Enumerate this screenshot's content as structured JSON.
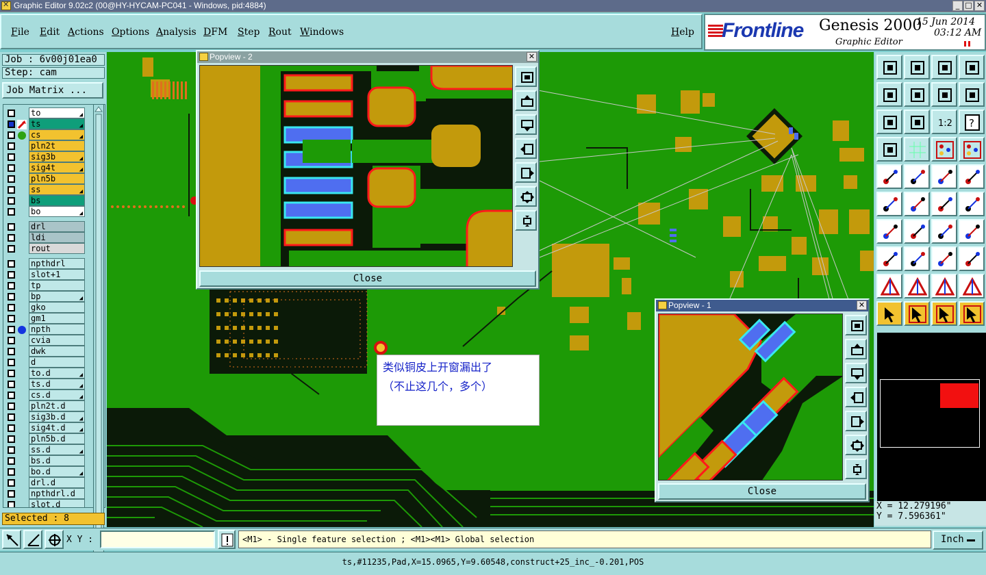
{
  "window": {
    "title": "Graphic Editor 9.02c2 (00@HY-HYCAM-PC041 - Windows, pid:4884)"
  },
  "menu": {
    "items": [
      "File",
      "Edit",
      "Actions",
      "Options",
      "Analysis",
      "DFM",
      "Step",
      "Rout",
      "Windows"
    ],
    "help": "Help"
  },
  "brand": {
    "logo": "Frontline",
    "product": "Genesis 2000",
    "subtitle": "Graphic Editor",
    "date": "15 Jun 2014",
    "time": "03:12 AM"
  },
  "job": {
    "job_label": "Job : 6v00j01ea0",
    "step_label": "Step: cam",
    "matrix_button": "Job Matrix ..."
  },
  "layers": [
    {
      "name": "to",
      "bg": "#ffffff",
      "arrow": true
    },
    {
      "name": "ts",
      "bg": "#0f9e7a",
      "arrow": true,
      "mark": "work"
    },
    {
      "name": "cs",
      "bg": "#f2c22f",
      "arrow": true,
      "mark": "green-dot"
    },
    {
      "name": "pln2t",
      "bg": "#f2c22f",
      "arrow": false
    },
    {
      "name": "sig3b",
      "bg": "#f2c22f",
      "arrow": true
    },
    {
      "name": "sig4t",
      "bg": "#f2c22f",
      "arrow": true
    },
    {
      "name": "pln5b",
      "bg": "#f2c22f",
      "arrow": false
    },
    {
      "name": "ss",
      "bg": "#f2c22f",
      "arrow": true
    },
    {
      "name": "bs",
      "bg": "#0f9e7a",
      "arrow": false
    },
    {
      "name": "bo",
      "bg": "#ffffff",
      "arrow": true
    },
    {
      "name": "drl",
      "bg": "#a9c4c8",
      "arrow": false
    },
    {
      "name": "ldi",
      "bg": "#a9c4c8",
      "arrow": false
    },
    {
      "name": "rout",
      "bg": "#d9d9d9",
      "arrow": false
    },
    {
      "name": "npthdrl",
      "bg": "#bfe8e8",
      "arrow": false
    },
    {
      "name": "slot+1",
      "bg": "#bfe8e8",
      "arrow": false
    },
    {
      "name": "tp",
      "bg": "#bfe8e8",
      "arrow": false
    },
    {
      "name": "bp",
      "bg": "#bfe8e8",
      "arrow": true
    },
    {
      "name": "gko",
      "bg": "#bfe8e8",
      "arrow": false
    },
    {
      "name": "gm1",
      "bg": "#bfe8e8",
      "arrow": false
    },
    {
      "name": "npth",
      "bg": "#bfe8e8",
      "arrow": false,
      "mark": "blue-dot"
    },
    {
      "name": "cvia",
      "bg": "#bfe8e8",
      "arrow": false
    },
    {
      "name": "dwk",
      "bg": "#bfe8e8",
      "arrow": false
    },
    {
      "name": "d",
      "bg": "#bfe8e8",
      "arrow": false
    },
    {
      "name": "to.d",
      "bg": "#bfe8e8",
      "arrow": true
    },
    {
      "name": "ts.d",
      "bg": "#bfe8e8",
      "arrow": true
    },
    {
      "name": "cs.d",
      "bg": "#bfe8e8",
      "arrow": true
    },
    {
      "name": "pln2t.d",
      "bg": "#bfe8e8",
      "arrow": false
    },
    {
      "name": "sig3b.d",
      "bg": "#bfe8e8",
      "arrow": true
    },
    {
      "name": "sig4t.d",
      "bg": "#bfe8e8",
      "arrow": true
    },
    {
      "name": "pln5b.d",
      "bg": "#bfe8e8",
      "arrow": false
    },
    {
      "name": "ss.d",
      "bg": "#bfe8e8",
      "arrow": true
    },
    {
      "name": "bs.d",
      "bg": "#bfe8e8",
      "arrow": false
    },
    {
      "name": "bo.d",
      "bg": "#bfe8e8",
      "arrow": true
    },
    {
      "name": "drl.d",
      "bg": "#bfe8e8",
      "arrow": false
    },
    {
      "name": "npthdrl.d",
      "bg": "#bfe8e8",
      "arrow": false
    },
    {
      "name": "slot.d",
      "bg": "#bfe8e8",
      "arrow": false
    }
  ],
  "selected_label": "Selected : 8",
  "popview2": {
    "title": "Popview - 2",
    "close_label": "Close"
  },
  "popview1": {
    "title": "Popview - 1",
    "close_label": "Close"
  },
  "annotation": {
    "line1": "类似铜皮上开窗漏出了",
    "line2": "（不止这几个，多个）"
  },
  "coordinates": {
    "x": "X = 12.279196\"",
    "y": "Y = 7.596361\""
  },
  "bottom": {
    "xy_label": "X Y :",
    "xy_value": "",
    "hint": "<M1> - Single feature selection ; <M1><M1> Global selection",
    "units": "Inch"
  },
  "status": "ts,#11235,Pad,X=15.0965,Y=9.60548,construct+25_inc_-0.201,POS",
  "colors": {
    "board": "#1d9a06",
    "copper": "#c39a0c",
    "selected_pad": "#4f6ef0",
    "highlight": "#ff1a1a",
    "panel": "#a7dcdc"
  }
}
